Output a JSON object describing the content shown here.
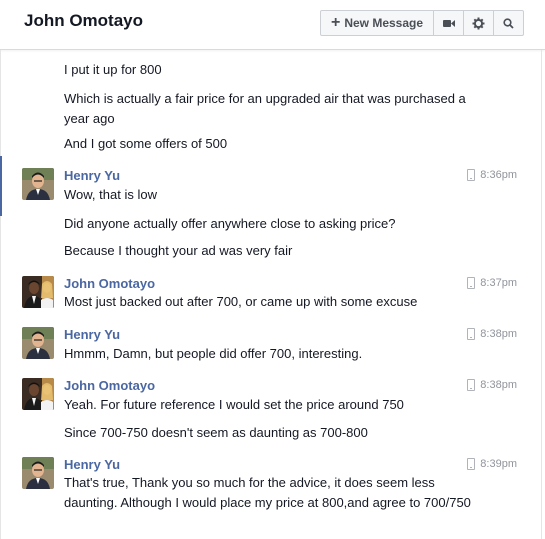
{
  "header": {
    "title": "John Omotayo",
    "new_message_label": "New Message",
    "new_message_icon": "plus-icon",
    "video_icon": "video-camera-icon",
    "settings_icon": "gear-icon",
    "search_icon": "search-icon"
  },
  "colors": {
    "sender_name": "#4b67a1",
    "timestamp": "#90949c",
    "text": "#141823"
  },
  "messages": [
    {
      "text": "I put it up for 800"
    },
    {
      "text": "Which is actually a fair price for an upgraded air that was purchased a year ago"
    },
    {
      "text": "And I got some offers of 500"
    }
  ],
  "groups": [
    {
      "sender": "Henry Yu",
      "avatar_icon": "henry-yu-avatar",
      "time": "8:36pm",
      "device_icon": "mobile-phone-icon",
      "lines": [
        "Wow, that is low",
        "Did anyone actually offer anywhere close to asking price?",
        "Because I thought your ad was very fair"
      ]
    },
    {
      "sender": "John Omotayo",
      "avatar_icon": "john-omotayo-avatar",
      "time": "8:37pm",
      "device_icon": "mobile-phone-icon",
      "lines": [
        "Most just backed out after 700, or came up with some excuse"
      ]
    },
    {
      "sender": "Henry Yu",
      "avatar_icon": "henry-yu-avatar",
      "time": "8:38pm",
      "device_icon": "mobile-phone-icon",
      "lines": [
        "Hmmm, Damn, but people did offer 700, interesting."
      ]
    },
    {
      "sender": "John Omotayo",
      "avatar_icon": "john-omotayo-avatar",
      "time": "8:38pm",
      "device_icon": "mobile-phone-icon",
      "lines": [
        "Yeah. For future reference I would set the price around 750",
        "Since 700-750 doesn't seem as daunting as 700-800"
      ]
    },
    {
      "sender": "Henry Yu",
      "avatar_icon": "henry-yu-avatar",
      "time": "8:39pm",
      "device_icon": "mobile-phone-icon",
      "lines": [
        "That's true, Thank you so much for the advice, it does seem less daunting. Although I would place my price at 800,and agree to 700/750"
      ]
    }
  ]
}
